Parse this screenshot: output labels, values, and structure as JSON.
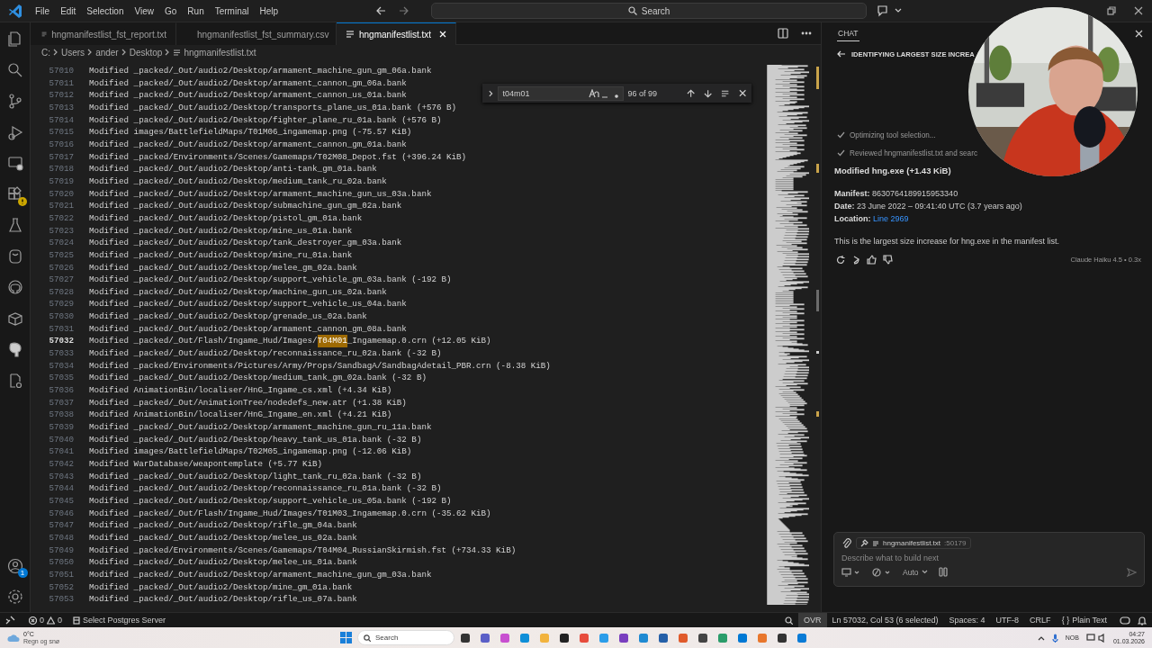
{
  "menu_bar": {
    "items": [
      "File",
      "Edit",
      "Selection",
      "View",
      "Go",
      "Run",
      "Terminal",
      "Help"
    ],
    "search": {
      "placeholder": "Search"
    }
  },
  "tabs": [
    {
      "label": "hngmanifestlist_fst_report.txt",
      "kind": "text",
      "selected": false
    },
    {
      "label": "hngmanifestlist_fst_summary.csv",
      "kind": "csv",
      "selected": false
    },
    {
      "label": "hngmanifestlist.txt",
      "kind": "text",
      "selected": true
    }
  ],
  "breadcrumb": [
    "C:",
    "Users",
    "ander",
    "Desktop",
    "hngmanifestlist.txt"
  ],
  "find_widget": {
    "query": "t04m01",
    "match_count": "96 of 99"
  },
  "editor": {
    "lines": [
      {
        "number": "57010",
        "text": "Modified _packed/_Out/audio2/Desktop/armament_machine_gun_gm_06a.bank",
        "current": false
      },
      {
        "number": "57011",
        "text": "Modified _packed/_Out/audio2/Desktop/armament_cannon_gm_06a.bank",
        "current": false
      },
      {
        "number": "57012",
        "text": "Modified _packed/_Out/audio2/Desktop/armament_cannon_us_01a.bank",
        "current": false
      },
      {
        "number": "57013",
        "text": "Modified _packed/_Out/audio2/Desktop/transports_plane_us_01a.bank (+576 B)",
        "current": false
      },
      {
        "number": "57014",
        "text": "Modified _packed/_Out/audio2/Desktop/fighter_plane_ru_01a.bank (+576 B)",
        "current": false
      },
      {
        "number": "57015",
        "text": "Modified images/BattlefieldMaps/T01M06_ingamemap.png (-75.57 KiB)",
        "current": false
      },
      {
        "number": "57016",
        "text": "Modified _packed/_Out/audio2/Desktop/armament_cannon_gm_01a.bank",
        "current": false
      },
      {
        "number": "57017",
        "text": "Modified _packed/Environments/Scenes/Gamemaps/T02M08_Depot.fst (+396.24 KiB)",
        "current": false
      },
      {
        "number": "57018",
        "text": "Modified _packed/_Out/audio2/Desktop/anti-tank_gm_01a.bank",
        "current": false
      },
      {
        "number": "57019",
        "text": "Modified _packed/_Out/audio2/Desktop/medium_tank_ru_02a.bank",
        "current": false
      },
      {
        "number": "57020",
        "text": "Modified _packed/_Out/audio2/Desktop/armament_machine_gun_us_03a.bank",
        "current": false
      },
      {
        "number": "57021",
        "text": "Modified _packed/_Out/audio2/Desktop/submachine_gun_gm_02a.bank",
        "current": false
      },
      {
        "number": "57022",
        "text": "Modified _packed/_Out/audio2/Desktop/pistol_gm_01a.bank",
        "current": false
      },
      {
        "number": "57023",
        "text": "Modified _packed/_Out/audio2/Desktop/mine_us_01a.bank",
        "current": false
      },
      {
        "number": "57024",
        "text": "Modified _packed/_Out/audio2/Desktop/tank_destroyer_gm_03a.bank",
        "current": false
      },
      {
        "number": "57025",
        "text": "Modified _packed/_Out/audio2/Desktop/mine_ru_01a.bank",
        "current": false
      },
      {
        "number": "57026",
        "text": "Modified _packed/_Out/audio2/Desktop/melee_gm_02a.bank",
        "current": false
      },
      {
        "number": "57027",
        "text": "Modified _packed/_Out/audio2/Desktop/support_vehicle_gm_03a.bank (-192 B)",
        "current": false
      },
      {
        "number": "57028",
        "text": "Modified _packed/_Out/audio2/Desktop/machine_gun_us_02a.bank",
        "current": false
      },
      {
        "number": "57029",
        "text": "Modified _packed/_Out/audio2/Desktop/support_vehicle_us_04a.bank",
        "current": false
      },
      {
        "number": "57030",
        "text": "Modified _packed/_Out/audio2/Desktop/grenade_us_02a.bank",
        "current": false
      },
      {
        "number": "57031",
        "text": "Modified _packed/_Out/audio2/Desktop/armament_cannon_gm_08a.bank",
        "current": false
      },
      {
        "number": "57032",
        "text": "Modified _packed/_Out/Flash/Ingame_Hud/Images/",
        "match": "T04M01",
        "after": "_Ingamemap.0.crn (+12.05 KiB)",
        "current": true
      },
      {
        "number": "57033",
        "text": "Modified _packed/_Out/audio2/Desktop/reconnaissance_ru_02a.bank (-32 B)",
        "current": false
      },
      {
        "number": "57034",
        "text": "Modified _packed/Environments/Pictures/Army/Props/SandbagA/SandbagAdetail_PBR.crn (-8.38 KiB)",
        "current": false
      },
      {
        "number": "57035",
        "text": "Modified _packed/_Out/audio2/Desktop/medium_tank_gm_02a.bank (-32 B)",
        "current": false
      },
      {
        "number": "57036",
        "text": "Modified AnimationBin/localiser/HnG_Ingame_cs.xml (+4.34 KiB)",
        "current": false
      },
      {
        "number": "57037",
        "text": "Modified _packed/_Out/AnimationTree/nodedefs_new.atr (+1.38 KiB)",
        "current": false
      },
      {
        "number": "57038",
        "text": "Modified AnimationBin/localiser/HnG_Ingame_en.xml (+4.21 KiB)",
        "current": false
      },
      {
        "number": "57039",
        "text": "Modified _packed/_Out/audio2/Desktop/armament_machine_gun_ru_11a.bank",
        "current": false
      },
      {
        "number": "57040",
        "text": "Modified _packed/_Out/audio2/Desktop/heavy_tank_us_01a.bank (-32 B)",
        "current": false
      },
      {
        "number": "57041",
        "text": "Modified images/BattlefieldMaps/T02M05_ingamemap.png (-12.06 KiB)",
        "current": false
      },
      {
        "number": "57042",
        "text": "Modified WarDatabase/weapontemplate (+5.77 KiB)",
        "current": false
      },
      {
        "number": "57043",
        "text": "Modified _packed/_Out/audio2/Desktop/light_tank_ru_02a.bank (-32 B)",
        "current": false
      },
      {
        "number": "57044",
        "text": "Modified _packed/_Out/audio2/Desktop/reconnaissance_ru_01a.bank (-32 B)",
        "current": false
      },
      {
        "number": "57045",
        "text": "Modified _packed/_Out/audio2/Desktop/support_vehicle_us_05a.bank (-192 B)",
        "current": false
      },
      {
        "number": "57046",
        "text": "Modified _packed/_Out/Flash/Ingame_Hud/Images/T01M03_Ingamemap.0.crn (-35.62 KiB)",
        "current": false
      },
      {
        "number": "57047",
        "text": "Modified _packed/_Out/audio2/Desktop/rifle_gm_04a.bank",
        "current": false
      },
      {
        "number": "57048",
        "text": "Modified _packed/_Out/audio2/Desktop/melee_us_02a.bank",
        "current": false
      },
      {
        "number": "57049",
        "text": "Modified _packed/Environments/Scenes/Gamemaps/T04M04_RussianSkirmish.fst (+734.33 KiB)",
        "current": false
      },
      {
        "number": "57050",
        "text": "Modified _packed/_Out/audio2/Desktop/melee_us_01a.bank",
        "current": false
      },
      {
        "number": "57051",
        "text": "Modified _packed/_Out/audio2/Desktop/armament_machine_gun_gm_03a.bank",
        "current": false
      },
      {
        "number": "57052",
        "text": "Modified _packed/_Out/audio2/Desktop/mine_gm_01a.bank",
        "current": false
      },
      {
        "number": "57053",
        "text": "Modified _packed/_Out/audio2/Desktop/rifle_us_07a.bank",
        "current": false
      }
    ]
  },
  "activity_bar": {
    "account_badge": "1"
  },
  "chat": {
    "header": "CHAT",
    "title": "IDENTIFYING LARGEST SIZE INCREA",
    "steps": [
      "Optimizing tool selection...",
      "Reviewed hngmanifestlist.txt and searc"
    ],
    "heading": "Modified hng.exe (+1.43 KiB)",
    "fields": [
      {
        "label": "Manifest:",
        "value": "8630764189915953340",
        "kind": "text"
      },
      {
        "label": "Date:",
        "value": "23 June 2022 – 09:41:40 UTC (3.7 years ago)",
        "kind": "text"
      },
      {
        "label": "Location:",
        "value": "Line 2969",
        "kind": "link"
      }
    ],
    "summary": "This is the largest size increase for hng.exe in the manifest list.",
    "model": "Claude Haiku 4.5 • 0.3x",
    "input": {
      "context_file": "hngmanifestlist.txt",
      "context_line": ":50179",
      "placeholder": "Describe what to build next",
      "mode": "Auto"
    }
  },
  "status_bar": {
    "errors": "0",
    "warnings": "0",
    "left_item": "Select Postgres Server",
    "right_items": [
      "OVR",
      "Ln 57032, Col 53 (6 selected)",
      "Spaces: 4",
      "UTF-8",
      "CRLF"
    ],
    "language_braces": "{ }",
    "language": "Plain Text"
  },
  "taskbar": {
    "weather": {
      "temp": "0°C",
      "desc": "Regn og snø"
    },
    "search_placeholder": "Search",
    "keyboard": "NOB",
    "time": "04:27",
    "date": "01.03.2026"
  }
}
